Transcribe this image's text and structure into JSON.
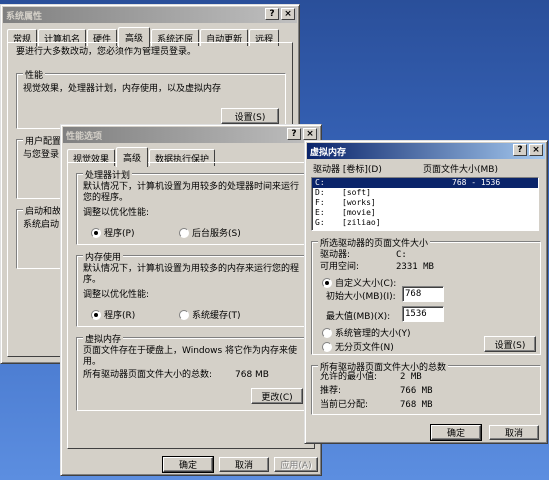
{
  "sysprop": {
    "title": "系统属性",
    "tabs": [
      "常规",
      "计算机名",
      "硬件",
      "高级",
      "系统还原",
      "自动更新",
      "远程"
    ],
    "admin_note": "要进行大多数改动，您必须作为管理员登录。",
    "perf_title": "性能",
    "perf_desc": "视觉效果，处理器计划，内存使用，以及虚拟内存",
    "settings_btn": "设置(S)",
    "profile_title": "用户配置",
    "profile_desc": "与您登录",
    "startup_title": "启动和故",
    "startup_desc": "系统启动"
  },
  "perfopt": {
    "title": "性能选项",
    "tabs": [
      "视觉效果",
      "高级",
      "数据执行保护"
    ],
    "cpu": {
      "title": "处理器计划",
      "desc": "默认情况下，计算机设置为用较多的处理器时间来运行您的程序。",
      "label": "调整以优化性能:",
      "opt1": "程序(P)",
      "opt2": "后台服务(S)"
    },
    "mem": {
      "title": "内存使用",
      "desc": "默认情况下，计算机设置为用较多的内存来运行您的程序。",
      "label": "调整以优化性能:",
      "opt1": "程序(R)",
      "opt2": "系统缓存(T)"
    },
    "vm": {
      "title": "虚拟内存",
      "desc": "页面文件存在于硬盘上，Windows 将它作为内存来使用。",
      "total_label": "所有驱动器页面文件大小的总数:",
      "total_value": "768 MB",
      "change_btn": "更改(C)"
    },
    "ok": "确定",
    "cancel": "取消",
    "apply": "应用(A)"
  },
  "vmem": {
    "title": "虚拟内存",
    "col_drive": "驱动器 [卷标](D)",
    "col_size": "页面文件大小(MB)",
    "drives": [
      {
        "drive": "C:",
        "label": "",
        "size": "768 - 1536",
        "selected": true
      },
      {
        "drive": "D:",
        "label": "[soft]",
        "size": ""
      },
      {
        "drive": "F:",
        "label": "[works]",
        "size": ""
      },
      {
        "drive": "E:",
        "label": "[movie]",
        "size": ""
      },
      {
        "drive": "G:",
        "label": "[ziliao]",
        "size": ""
      }
    ],
    "sel": {
      "title": "所选驱动器的页面文件大小",
      "drive_label": "驱动器:",
      "drive_value": "C:",
      "free_label": "可用空间:",
      "free_value": "2331 MB",
      "custom": "自定义大小(C):",
      "initial_label": "初始大小(MB)(I):",
      "initial_value": "768",
      "max_label": "最大值(MB)(X):",
      "max_value": "1536",
      "managed": "系统管理的大小(Y)",
      "none": "无分页文件(N)",
      "set_btn": "设置(S)"
    },
    "totals": {
      "title": "所有驱动器页面文件大小的总数",
      "min_label": "允许的最小值:",
      "min_value": "2 MB",
      "rec_label": "推荐:",
      "rec_value": "766 MB",
      "cur_label": "当前已分配:",
      "cur_value": "768 MB"
    },
    "ok": "确定",
    "cancel": "取消"
  },
  "titlebar": {
    "help": "?",
    "close": "×"
  }
}
